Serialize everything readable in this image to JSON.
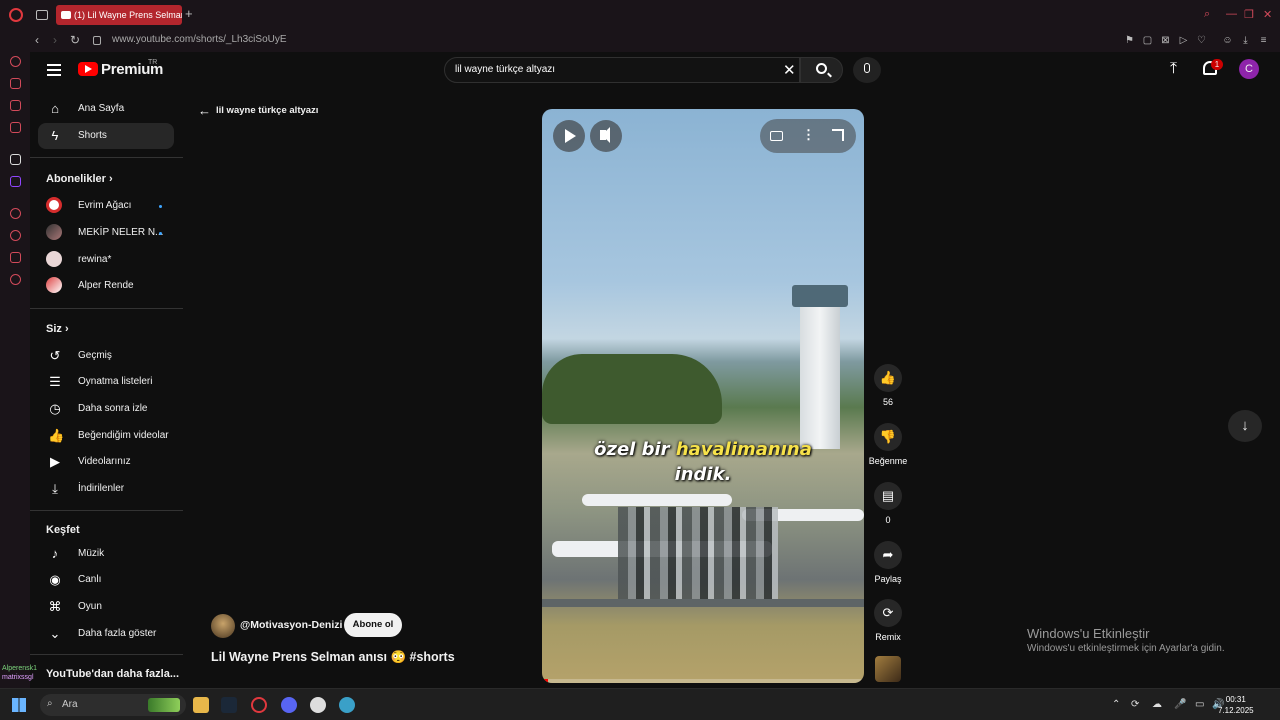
{
  "browser": {
    "tab_title": "(1) Lil Wayne Prens Selman anısı",
    "url": "www.youtube.com/shorts/_Lh3ciSoUyE"
  },
  "header": {
    "logo_text": "Premium",
    "logo_region": "TR",
    "search_value": "lil wayne türkçe altyazı",
    "notification_count": "1",
    "avatar_letter": "C"
  },
  "sidebar": {
    "main": [
      {
        "label": "Ana Sayfa",
        "icon": "home-icon"
      },
      {
        "label": "Shorts",
        "icon": "shorts-icon"
      }
    ],
    "subscriptions_title": "Abonelikler",
    "subscriptions": [
      {
        "label": "Evrim Ağacı",
        "new": true
      },
      {
        "label": "MEKİP NELER N...",
        "new": true
      },
      {
        "label": "rewina*",
        "new": false
      },
      {
        "label": "Alper Rende",
        "new": false
      }
    ],
    "you_title": "Siz",
    "you": [
      {
        "label": "Geçmiş",
        "icon": "history-icon"
      },
      {
        "label": "Oynatma listeleri",
        "icon": "playlist-icon"
      },
      {
        "label": "Daha sonra izle",
        "icon": "clock-icon"
      },
      {
        "label": "Beğendiğim videolar",
        "icon": "thumbs-up-icon"
      },
      {
        "label": "Videolarınız",
        "icon": "video-icon"
      },
      {
        "label": "İndirilenler",
        "icon": "download-icon"
      }
    ],
    "explore_title": "Keşfet",
    "explore": [
      {
        "label": "Müzik",
        "icon": "music-icon"
      },
      {
        "label": "Canlı",
        "icon": "live-icon"
      },
      {
        "label": "Oyun",
        "icon": "gaming-icon"
      },
      {
        "label": "Daha fazla göster",
        "icon": "chevron-down-icon"
      }
    ],
    "more_from": "YouTube'dan daha fazla..."
  },
  "back": {
    "label": "lil wayne türkçe altyazı"
  },
  "video": {
    "caption_line1_white": "özel bir",
    "caption_line1_yellow": "havalimanına",
    "caption_line2": "indik.",
    "progress": 0.02
  },
  "actions": {
    "likes": "56",
    "dislike_label": "Beğenme",
    "comments": "0",
    "share_label": "Paylaş",
    "remix_label": "Remix"
  },
  "channel": {
    "handle": "@Motivasyon-Denizi",
    "subscribe_label": "Abone ol"
  },
  "title": "Lil Wayne Prens Selman anısı 😳 #shorts",
  "windows_activation": {
    "line1": "Windows'u Etkinleştir",
    "line2": "Windows'u etkinleştirmek için Ayarlar'a gidin."
  },
  "chat": {
    "user1": "Alperensk1",
    "user2": "matrixssgl"
  },
  "taskbar": {
    "search_placeholder": "Ara",
    "time": "00:31",
    "date": "7.12.2025"
  }
}
